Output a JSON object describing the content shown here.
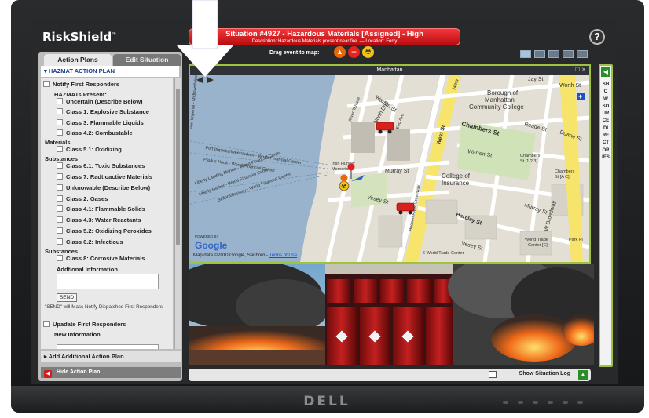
{
  "app": {
    "logo": "RiskShield",
    "trademark": "™"
  },
  "banner": {
    "title": "Situation #4927 - Hazardous Materials [Assigned] - High",
    "description": "Description: Hazardous Materials present near fire.  — Location: Ferry"
  },
  "toolbar": {
    "drag_label": "Drag event to map:",
    "help_glyph": "?",
    "drag_icons": [
      "fire-icon",
      "medical-cross-icon",
      "radiation-icon"
    ]
  },
  "tabs": {
    "action_plans": "Action Plans",
    "edit_situation": "Edit Situation"
  },
  "plan": {
    "header": "HAZMAT ACTION PLAN",
    "notify": "Notify First Responders",
    "hazmats_present": "HAZMATs Present:",
    "items": [
      "Uncertain (Describe Below)",
      "Class 1: Explosive Substance",
      "Class 3: Flammable Liquids",
      "Class 4.2: Combustable"
    ],
    "materials": "Materials",
    "item_51": "Class 5.1: Oxidizing",
    "substances_1": "Substances",
    "items2": [
      "Class 6.1: Toxic Substances",
      "Class 7: Radtioactive Materials",
      "Unknowable (Describe Below)",
      "Class 2: Gases",
      "Class 4.1: Flammable Solids",
      "Class 4.3: Water Reactants",
      "Class 5.2: Oxidizing Peroxides",
      "Class 6.2: Infectious"
    ],
    "substances_2": "Substances",
    "item_8": "Class 8: Corrosive Materials",
    "additional_info": "Addtional Information",
    "send": "SEND",
    "send_note": "\"SEND\" will Mass Notify Dispatched First Responders",
    "update": "Upadate First Responders",
    "new_info": "New Information",
    "add_additional": "Add Additional Action Plan",
    "hide": "Hide Action Plan"
  },
  "map": {
    "title": "Manhattan",
    "controls": "☐ ✕",
    "powered_by": "POWERED BY",
    "google": "Google",
    "data_credit": "Map data ©2010 Google, Sanborn - ",
    "terms": "Terms of Use",
    "labels": {
      "jay_st": "Jay St",
      "worth_st": "Worth St",
      "warren_st": "Warren St",
      "borough": "Borough of",
      "manhattan_cc1": "Manhattan",
      "manhattan_cc2": "Community College",
      "chambers_st": "Chambers St",
      "reade_st": "Reade St",
      "duane_st": "Duane St",
      "new_york": "New",
      "west_st": "West St",
      "river_terrace": "River Terrace",
      "end_ave": "End Ave",
      "n_end": "North End",
      "murray_st": "Murray St",
      "warren_st2": "Warren St",
      "college1": "College of",
      "college2": "Insurance",
      "irish1": "Irish Hunger",
      "irish2": "Memorial",
      "vesey_st": "Vesey St",
      "vesey_st2": "Vesey St",
      "barclay_st": "Barclay St",
      "murray_st2": "Murray St",
      "w_broadway": "W Broadway",
      "chambers_station1": "Chambers",
      "chambers_station2": "St [1 2 3]",
      "chambers_ac1": "Chambers",
      "chambers_ac2": "St [A C]",
      "wtc1": "World Trade",
      "wtc2": "Center [E]",
      "park_pl": "Park Pl",
      "six_wtc": "6 World Trade Center",
      "ferry1": "Port Imperial/Weehawken - World Financial Center",
      "ferry2": "Paulus Hook - World Financial Center",
      "ferry3": "Liberty Landing Marina - World Financial Center",
      "ferry4": "Liberty Harbor - World Financial Center",
      "ferry5": "Belford/Bayway - World Financial Center",
      "ferry6": "Port Imperial - Midtown/West 39th",
      "hudson": "Hudson River Greenway"
    }
  },
  "source_directories": {
    "label": "SHOW SOURCE DIRECTORIES"
  },
  "situation_log": {
    "label": "Show Situation Log"
  },
  "monitor": {
    "brand": "DELL"
  },
  "colors": {
    "accent_green": "#9ec33c",
    "banner_red": "#d81e20",
    "title_blue": "#1d3d8f"
  }
}
